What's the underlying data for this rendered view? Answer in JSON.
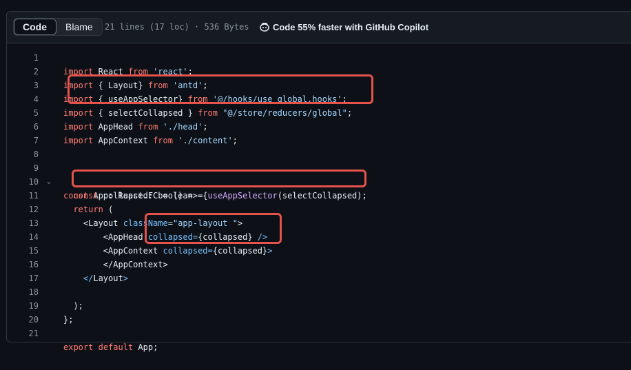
{
  "header": {
    "code_tab": "Code",
    "blame_tab": "Blame",
    "meta": "21 lines (17 loc) · 536 Bytes",
    "copilot": "Code 55% faster with GitHub Copilot"
  },
  "lines": [
    {
      "n": "1"
    },
    {
      "n": "2"
    },
    {
      "n": "3"
    },
    {
      "n": "4"
    },
    {
      "n": "5"
    },
    {
      "n": "6"
    },
    {
      "n": "7"
    },
    {
      "n": "8"
    },
    {
      "n": "9"
    },
    {
      "n": "10"
    },
    {
      "n": "11"
    },
    {
      "n": "12"
    },
    {
      "n": "13"
    },
    {
      "n": "14"
    },
    {
      "n": "15"
    },
    {
      "n": "16"
    },
    {
      "n": "17"
    },
    {
      "n": "18"
    },
    {
      "n": "19"
    },
    {
      "n": "20"
    },
    {
      "n": "21"
    }
  ],
  "code": {
    "l1": [
      "import",
      " React ",
      "from",
      " 'react'",
      ";"
    ],
    "l2": [
      "import",
      " { Layout} ",
      "from",
      " 'antd'",
      ";"
    ],
    "l3": [
      "import",
      " { useAppSelector} ",
      "from",
      " '@/hooks/use_global.hooks'",
      ";"
    ],
    "l4": [
      "import",
      " { selectCollapsed } ",
      "from",
      " \"@/store/reducers/global\"",
      ";"
    ],
    "l5": [
      "import",
      " AppHead ",
      "from",
      " './head'",
      ";"
    ],
    "l6": [
      "import",
      " AppContext ",
      "from",
      " './content'",
      ";"
    ],
    "l9": [
      "const",
      " App: React.FC = () => {"
    ],
    "l10": [
      "  ",
      "const",
      " collapsed: boolean = ",
      "useAppSelector",
      "(selectCollapsed);"
    ],
    "l11": [
      "  ",
      "return",
      " ("
    ],
    "l12": [
      "    <",
      "Layout",
      " ",
      "className",
      "=",
      "\"app-layout \"",
      ">"
    ],
    "l13": [
      "        <AppHead ",
      "collapsed=",
      "{collapsed} ",
      "/>"
    ],
    "l14": [
      "        <AppContext ",
      "collapsed=",
      "{collapsed}",
      ">"
    ],
    "l15": [
      "        </AppContext>"
    ],
    "l16": [
      "    </",
      "Layout",
      ">"
    ],
    "l18": [
      "  );"
    ],
    "l19": [
      "};"
    ],
    "l21": [
      "export",
      " ",
      "default",
      " App;"
    ]
  }
}
